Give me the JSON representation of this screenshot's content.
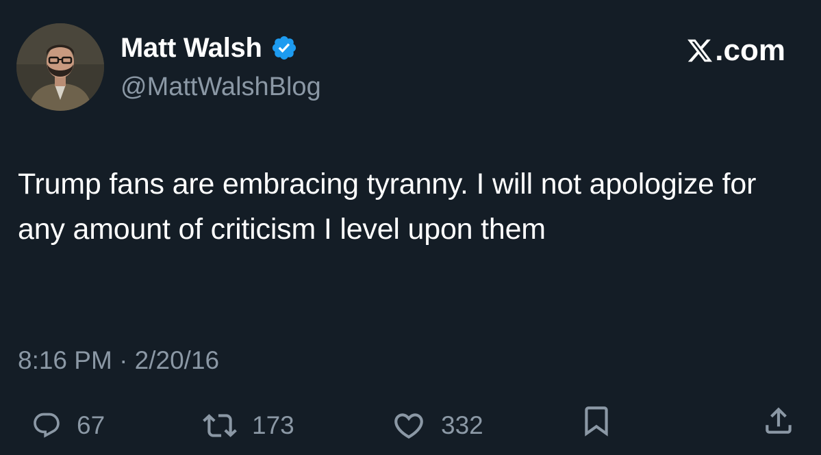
{
  "author": {
    "display_name": "Matt Walsh",
    "handle": "@MattWalshBlog",
    "verified": true,
    "verified_color": "#1d9bf0"
  },
  "brand": {
    "label": ".com",
    "logo_icon": "x-logo-icon"
  },
  "tweet": {
    "text": "Trump fans are embracing tyranny. I will not apologize for any amount of criticism I level upon them",
    "timestamp": "8:16 PM · 2/20/16"
  },
  "actions": {
    "reply": {
      "icon": "reply-icon",
      "count": "67"
    },
    "retweet": {
      "icon": "retweet-icon",
      "count": "173"
    },
    "like": {
      "icon": "heart-icon",
      "count": "332"
    },
    "bookmark": {
      "icon": "bookmark-icon"
    },
    "share": {
      "icon": "share-icon"
    }
  },
  "colors": {
    "background": "#141d26",
    "text": "#ffffff",
    "muted": "#8b98a5"
  }
}
